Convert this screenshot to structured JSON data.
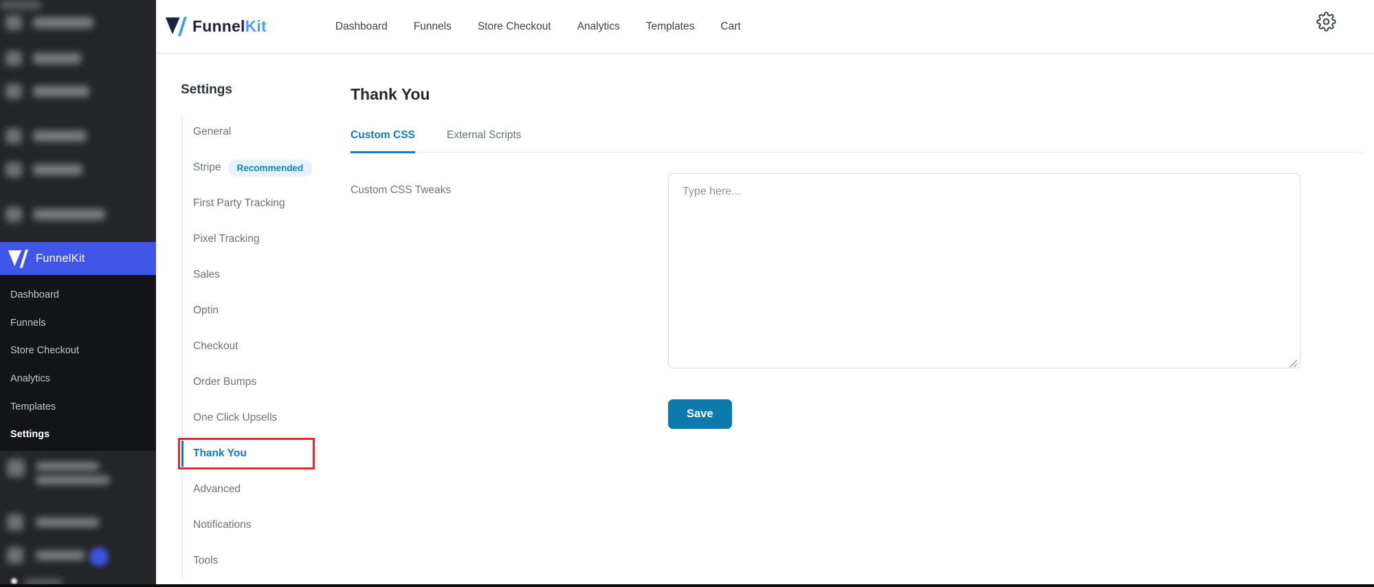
{
  "colors": {
    "accent_blue": "#0d7cbe",
    "save_button_blue": "#0c7bac",
    "sidebar_active_blue": "#3f56e7",
    "annotation_red": "#e5262c",
    "logo_navy": "#1e2144",
    "logo_light_blue": "#47a0f5",
    "badge_bg": "#e7f2fa"
  },
  "wp_sidebar": {
    "funnelkit": {
      "label": "FunnelKit"
    },
    "submenu": [
      {
        "label": "Dashboard"
      },
      {
        "label": "Funnels"
      },
      {
        "label": "Store Checkout"
      },
      {
        "label": "Analytics"
      },
      {
        "label": "Templates"
      },
      {
        "label": "Settings"
      }
    ],
    "active_submenu": "Settings"
  },
  "header": {
    "logo": {
      "part1": "Funnel",
      "part2": "Kit"
    },
    "nav": [
      {
        "label": "Dashboard"
      },
      {
        "label": "Funnels"
      },
      {
        "label": "Store Checkout"
      },
      {
        "label": "Analytics"
      },
      {
        "label": "Templates"
      },
      {
        "label": "Cart"
      }
    ]
  },
  "settings_nav": {
    "title": "Settings",
    "items": [
      {
        "label": "General"
      },
      {
        "label": "Stripe",
        "badge": "Recommended"
      },
      {
        "label": "First Party Tracking"
      },
      {
        "label": "Pixel Tracking"
      },
      {
        "label": "Sales"
      },
      {
        "label": "Optin"
      },
      {
        "label": "Checkout"
      },
      {
        "label": "Order Bumps"
      },
      {
        "label": "One Click Upsells"
      },
      {
        "label": "Thank You",
        "active": true,
        "annotated": true
      },
      {
        "label": "Advanced"
      },
      {
        "label": "Notifications"
      },
      {
        "label": "Tools"
      }
    ]
  },
  "main": {
    "title": "Thank You",
    "tabs": [
      {
        "label": "Custom CSS",
        "active": true
      },
      {
        "label": "External Scripts",
        "active": false
      }
    ],
    "custom_css": {
      "field_label": "Custom CSS Tweaks",
      "placeholder": "Type here...",
      "value": ""
    },
    "save_button": "Save"
  }
}
